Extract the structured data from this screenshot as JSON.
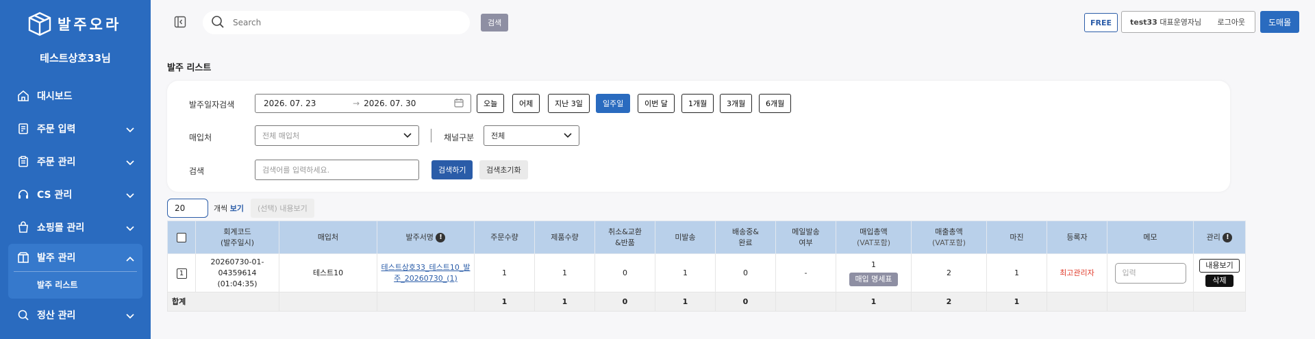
{
  "sidebar": {
    "logo_text": "발주오라",
    "shop_name": "테스트상호33님",
    "items": [
      {
        "label": "대시보드"
      },
      {
        "label": "주문 입력"
      },
      {
        "label": "주문 관리"
      },
      {
        "label": "CS 관리"
      },
      {
        "label": "쇼핑몰 관리"
      },
      {
        "label": "발주 관리",
        "sub": "발주 리스트"
      },
      {
        "label": "정산 관리"
      }
    ]
  },
  "topbar": {
    "search_placeholder": "Search",
    "search_button": "검색",
    "plan_badge": "FREE",
    "user_id": "test33",
    "user_role": "대표운영자님",
    "logout": "로그아웃",
    "market_button": "도매몰"
  },
  "page_title": "발주 리스트",
  "filters": {
    "date_label": "발주일자검색",
    "date_from": "2026. 07. 23",
    "date_arrow": "→",
    "date_to": "2026. 07. 30",
    "quick": [
      "오늘",
      "어제",
      "지난 3일",
      "일주일",
      "이번 달",
      "1개월",
      "3개월",
      "6개월"
    ],
    "quick_active": "일주일",
    "vendor_label": "매입처",
    "vendor_value": "전체 매입처",
    "channel_label": "채널구분",
    "channel_value": "전체",
    "search_label": "검색",
    "search_placeholder": "검색어를 입력하세요.",
    "search_button": "검색하기",
    "reset_button": "검색초기화"
  },
  "list": {
    "per_page": "20",
    "per_page_suffix": "개씩",
    "per_page_view": "보기",
    "view_selected": "(선택) 내용보기"
  },
  "table": {
    "headers": {
      "code": "회계코드",
      "code_sub": "(발주일시)",
      "vendor": "매입처",
      "order_name": "발주서명",
      "order_qty": "주문수량",
      "product_qty": "제품수량",
      "cancel": "취소&교환",
      "cancel_sub": "&반품",
      "unshipped": "미발송",
      "shipping": "배송중&",
      "shipping_sub": "완료",
      "mail": "메일발송",
      "mail_sub": "여부",
      "purchase": "매입총액",
      "purchase_sub": "(VAT포함)",
      "sales": "매출총액",
      "sales_sub": "(VAT포함)",
      "margin": "마진",
      "registrant": "등록자",
      "memo": "메모",
      "manage": "관리"
    },
    "rows": [
      {
        "num": "1",
        "code": "20260730-01-04359614",
        "time": "(01:04:35)",
        "vendor": "테스트10",
        "order_name": "테스트상호33_테스트10_발주_20260730_(1)",
        "order_qty": "1",
        "product_qty": "1",
        "cancel": "0",
        "unshipped": "1",
        "shipping": "0",
        "mail": "-",
        "purchase": "1",
        "purchase_badge": "매입 명세표",
        "sales": "2",
        "margin": "1",
        "registrant": "최고관리자",
        "memo_placeholder": "입력",
        "view_button": "내용보기",
        "delete_button": "삭제"
      }
    ],
    "summary": {
      "label": "합계",
      "order_qty": "1",
      "product_qty": "1",
      "cancel": "0",
      "unshipped": "1",
      "shipping": "0",
      "purchase": "1",
      "sales": "2",
      "margin": "1"
    }
  }
}
